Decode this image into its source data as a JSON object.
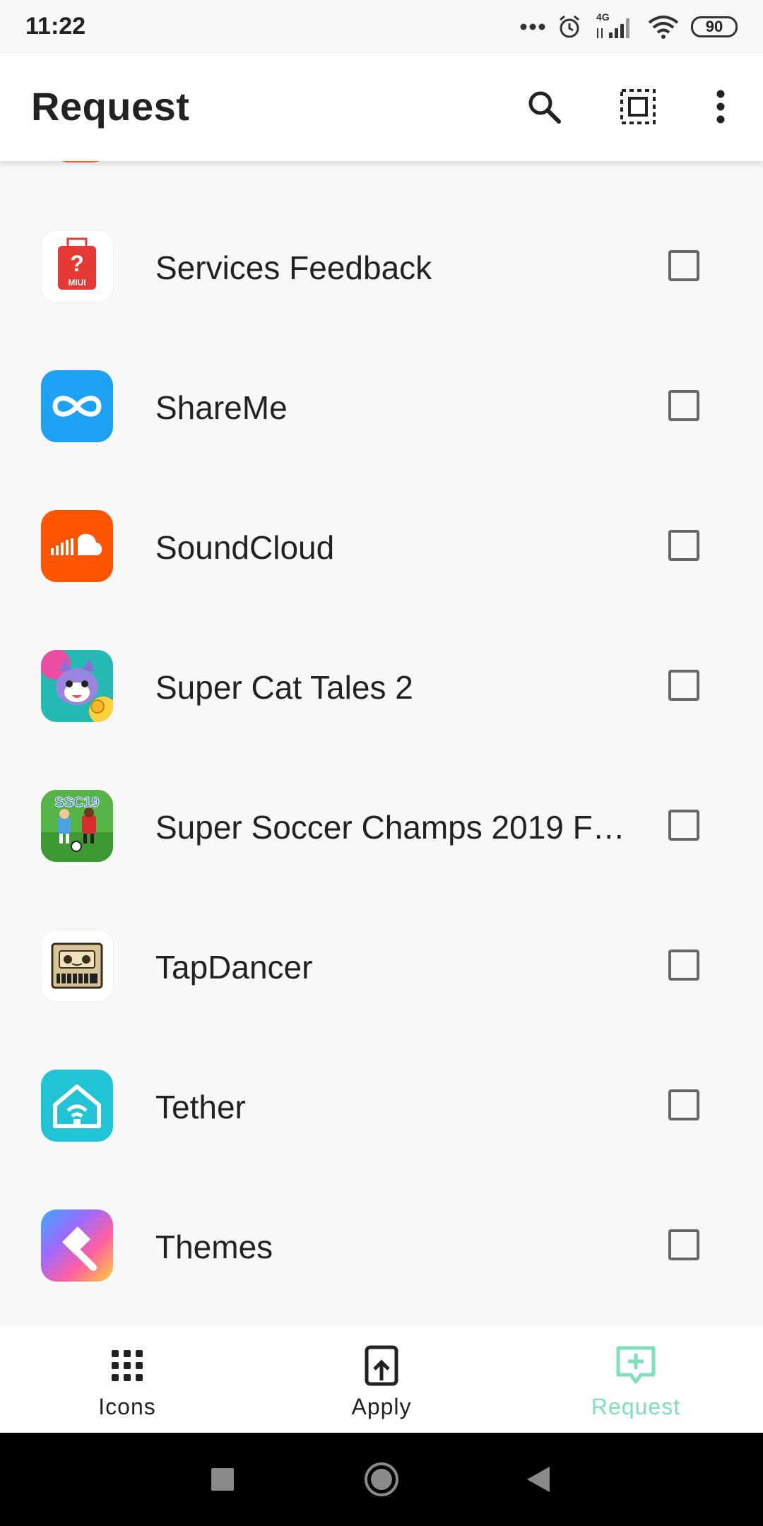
{
  "status_bar": {
    "time": "11:22",
    "battery": "90",
    "network": "4G"
  },
  "app_bar": {
    "title": "Request"
  },
  "apps": [
    {
      "name": "Services Feedback",
      "icon": "miui-feedback-icon"
    },
    {
      "name": "ShareMe",
      "icon": "shareme-icon"
    },
    {
      "name": "SoundCloud",
      "icon": "soundcloud-icon"
    },
    {
      "name": "Super Cat Tales 2",
      "icon": "super-cat-tales-icon"
    },
    {
      "name": "Super Soccer Champs 2019 FR…",
      "icon": "super-soccer-champs-icon"
    },
    {
      "name": "TapDancer",
      "icon": "tapdancer-icon"
    },
    {
      "name": "Tether",
      "icon": "tether-icon"
    },
    {
      "name": "Themes",
      "icon": "themes-icon"
    }
  ],
  "icon_texts": {
    "miui": "MIUI",
    "ssc": "SSC19"
  },
  "bottom_nav": [
    {
      "label": "Icons"
    },
    {
      "label": "Apply"
    },
    {
      "label": "Request"
    }
  ],
  "colors": {
    "accent": "#7ee0b8",
    "soundcloud": "#ff5500",
    "shareme": "#1da1f2",
    "tether": "#21c4d6"
  }
}
